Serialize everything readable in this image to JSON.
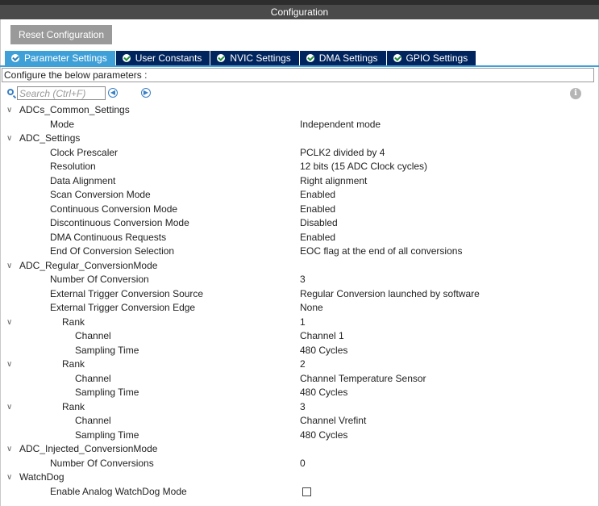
{
  "window": {
    "title": "Configuration"
  },
  "toolbar": {
    "reset_label": "Reset Configuration"
  },
  "tabs": [
    {
      "label": "Parameter Settings",
      "active": true
    },
    {
      "label": "User Constants",
      "active": false
    },
    {
      "label": "NVIC Settings",
      "active": false
    },
    {
      "label": "DMA Settings",
      "active": false
    },
    {
      "label": "GPIO Settings",
      "active": false
    }
  ],
  "configure_text": "Configure the below parameters :",
  "search": {
    "placeholder": "Search (Ctrl+F)",
    "value": ""
  },
  "icons": {
    "search": "search-icon",
    "prev": "arrow-left-circle-icon",
    "next": "arrow-right-circle-icon",
    "info": "info-icon",
    "check": "check-circle-icon",
    "collapse": "chevron-down-icon"
  },
  "colors": {
    "tab_active": "#3fa0d8",
    "tab_inactive": "#00245d",
    "reset_button": "#9a9a9a",
    "titlebar": "#4a4a4a"
  },
  "tree": {
    "g0": {
      "label": "ADCs_Common_Settings"
    },
    "mode": {
      "label": "Mode",
      "value": "Independent mode"
    },
    "g1": {
      "label": "ADC_Settings"
    },
    "clock": {
      "label": "Clock Prescaler",
      "value": "PCLK2 divided by 4"
    },
    "resolution": {
      "label": "Resolution",
      "value": "12 bits (15 ADC Clock cycles)"
    },
    "align": {
      "label": "Data Alignment",
      "value": "Right alignment"
    },
    "scan": {
      "label": "Scan Conversion Mode",
      "value": "Enabled"
    },
    "cont": {
      "label": "Continuous Conversion Mode",
      "value": "Enabled"
    },
    "discont": {
      "label": "Discontinuous Conversion Mode",
      "value": "Disabled"
    },
    "dma": {
      "label": "DMA Continuous Requests",
      "value": "Enabled"
    },
    "eoc": {
      "label": "End Of Conversion Selection",
      "value": "EOC flag at the end of all conversions"
    },
    "g2": {
      "label": "ADC_Regular_ConversionMode"
    },
    "numconv": {
      "label": "Number Of Conversion",
      "value": "3"
    },
    "trigsrc": {
      "label": "External Trigger Conversion Source",
      "value": "Regular Conversion launched by software"
    },
    "trigedge": {
      "label": "External Trigger Conversion Edge",
      "value": "None"
    },
    "rank1": {
      "label": "Rank",
      "value": "1"
    },
    "r1ch": {
      "label": "Channel",
      "value": "Channel 1"
    },
    "r1st": {
      "label": "Sampling Time",
      "value": "480 Cycles"
    },
    "rank2": {
      "label": "Rank",
      "value": "2"
    },
    "r2ch": {
      "label": "Channel",
      "value": "Channel Temperature Sensor"
    },
    "r2st": {
      "label": "Sampling Time",
      "value": "480 Cycles"
    },
    "rank3": {
      "label": "Rank",
      "value": "3"
    },
    "r3ch": {
      "label": "Channel",
      "value": "Channel Vrefint"
    },
    "r3st": {
      "label": "Sampling Time",
      "value": "480 Cycles"
    },
    "g3": {
      "label": "ADC_Injected_ConversionMode"
    },
    "numinj": {
      "label": "Number Of Conversions",
      "value": "0"
    },
    "g4": {
      "label": "WatchDog"
    },
    "awd": {
      "label": "Enable Analog WatchDog Mode",
      "checked": false
    }
  }
}
